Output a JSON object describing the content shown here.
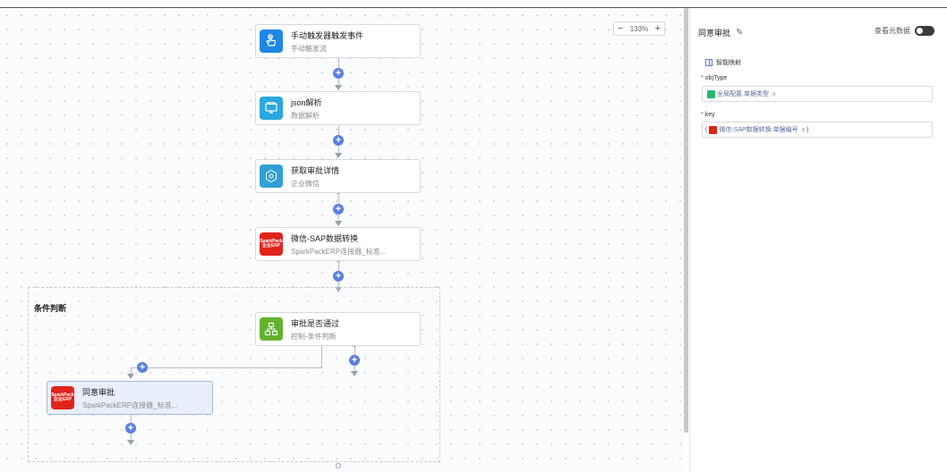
{
  "zoom": {
    "minus": "−",
    "value": "133%",
    "plus": "+"
  },
  "nodes": [
    {
      "title": "手动触发器触发事件",
      "subtitle": "手动触发流"
    },
    {
      "title": "json解析",
      "subtitle": "数据解析"
    },
    {
      "title": "获取审批详情",
      "subtitle": "企业微信"
    },
    {
      "title": "微信-SAP数据转换",
      "subtitle": "SparkPackERP连接器_标准...",
      "icon_text_top": "SparkPack",
      "icon_text_bottom": "企业ERP"
    },
    {
      "title": "审批是否通过",
      "subtitle": "控制-条件判断"
    },
    {
      "title": "同意审批",
      "subtitle": "SparkPackERP连接器_标准...",
      "icon_text_top": "SparkPack",
      "icon_text_bottom": "企业ERP"
    }
  ],
  "group": {
    "title": "条件判断"
  },
  "panel": {
    "title": "同意审批",
    "edit_icon": "✎",
    "toggle_label": "查看元数据",
    "smart_mapping": "智能映射",
    "fields": [
      {
        "required": "*",
        "label": "objType",
        "prefix": "",
        "value": "全局配置.单据类型",
        "remove": "x",
        "suffix": "",
        "tag_color": "#2bb673"
      },
      {
        "required": "*",
        "label": "key",
        "prefix": "(",
        "value": "微信-SAP数据转换.单据编号",
        "remove": "x",
        "suffix": ")",
        "tag_color": "#e2231a"
      }
    ]
  },
  "colors": {
    "accent": "#5b7fe0",
    "selected_node_bg": "#e8eefb"
  }
}
